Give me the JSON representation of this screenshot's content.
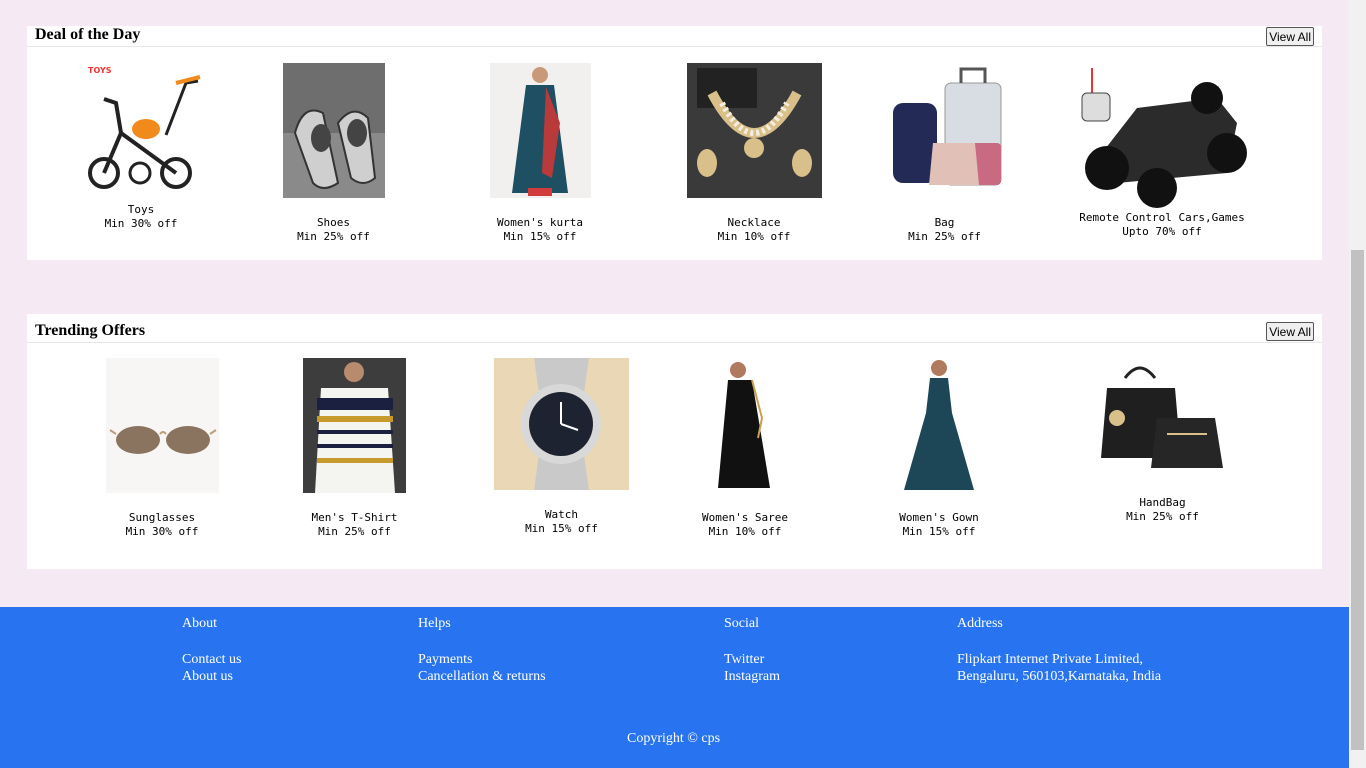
{
  "deal": {
    "title": "Deal of the Day",
    "view_all": "View All",
    "items": [
      {
        "name": "Toys",
        "offer": "Min 30% off"
      },
      {
        "name": "Shoes",
        "offer": "Min 25% off"
      },
      {
        "name": "Women's kurta",
        "offer": "Min 15% off"
      },
      {
        "name": "Necklace",
        "offer": "Min 10% off"
      },
      {
        "name": "Bag",
        "offer": "Min 25% off"
      },
      {
        "name": "Remote Control Cars,Games",
        "offer": "Upto 70% off"
      }
    ]
  },
  "trending": {
    "title": "Trending Offers",
    "view_all": "View All",
    "items": [
      {
        "name": "Sunglasses",
        "offer": "Min 30% off"
      },
      {
        "name": "Men's T-Shirt",
        "offer": "Min 25% off"
      },
      {
        "name": "Watch",
        "offer": "Min 15% off"
      },
      {
        "name": "Women's Saree",
        "offer": "Min 10% off"
      },
      {
        "name": "Women's Gown",
        "offer": "Min 15% off"
      },
      {
        "name": "HandBag",
        "offer": "Min 25% off"
      }
    ]
  },
  "footer": {
    "about": {
      "title": "About",
      "links": [
        "Contact us",
        "About us"
      ]
    },
    "helps": {
      "title": "Helps",
      "links": [
        "Payments",
        "Cancellation & returns"
      ]
    },
    "social": {
      "title": "Social",
      "links": [
        "Twitter",
        "Instagram"
      ]
    },
    "address": {
      "title": "Address",
      "lines": [
        "Flipkart Internet Private Limited,",
        "Bengaluru, 560103,Karnataka, India"
      ]
    },
    "copyright": "Copyright © cps"
  },
  "colors": {
    "page_bg": "#f5e9f3",
    "footer_bg": "#2874f0"
  }
}
